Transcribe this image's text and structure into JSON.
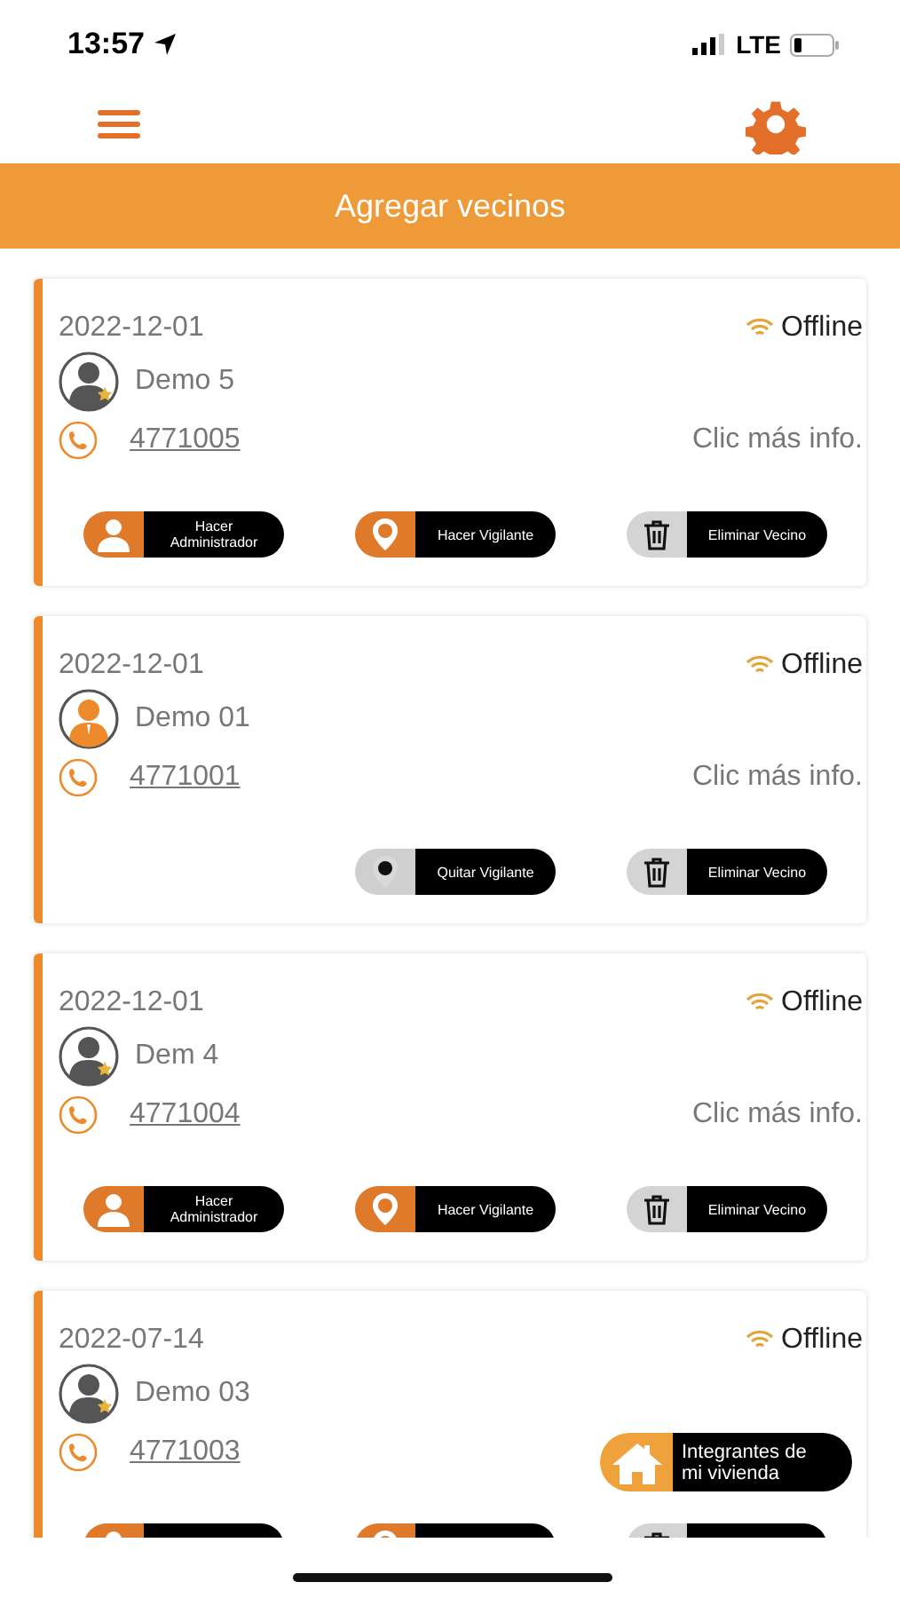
{
  "status_bar": {
    "time": "13:57",
    "network": "LTE"
  },
  "header": {
    "banner": "Agregar vecinos"
  },
  "neighbors": [
    {
      "date": "2022-12-01",
      "status": "Offline",
      "name": "Demo 5",
      "admin": false,
      "phone": "4771005",
      "info": "Clic más info.",
      "actions": [
        {
          "kind": "make-admin",
          "label": "Hacer Administrador"
        },
        {
          "kind": "make-guard",
          "label": "Hacer Vigilante"
        },
        {
          "kind": "remove",
          "label": "Eliminar Vecino"
        }
      ]
    },
    {
      "date": "2022-12-01",
      "status": "Offline",
      "name": "Demo 01",
      "admin": true,
      "phone": "4771001",
      "info": "Clic más info.",
      "actions": [
        {
          "kind": "remove-guard",
          "label": "Quitar Vigilante"
        },
        {
          "kind": "remove",
          "label": "Eliminar Vecino"
        }
      ]
    },
    {
      "date": "2022-12-01",
      "status": "Offline",
      "name": "Dem 4",
      "admin": false,
      "phone": "4771004",
      "info": "Clic más info.",
      "actions": [
        {
          "kind": "make-admin",
          "label": "Hacer Administrador"
        },
        {
          "kind": "make-guard",
          "label": "Hacer Vigilante"
        },
        {
          "kind": "remove",
          "label": "Eliminar Vecino"
        }
      ]
    },
    {
      "date": "2022-07-14",
      "status": "Offline",
      "name": "Demo 03",
      "admin": false,
      "phone": "4771003",
      "actions": [
        {
          "kind": "make-admin"
        },
        {
          "kind": "make-guard"
        },
        {
          "kind": "remove"
        }
      ]
    }
  ],
  "floating_button": {
    "label": "Integrantes de mi vivienda"
  }
}
